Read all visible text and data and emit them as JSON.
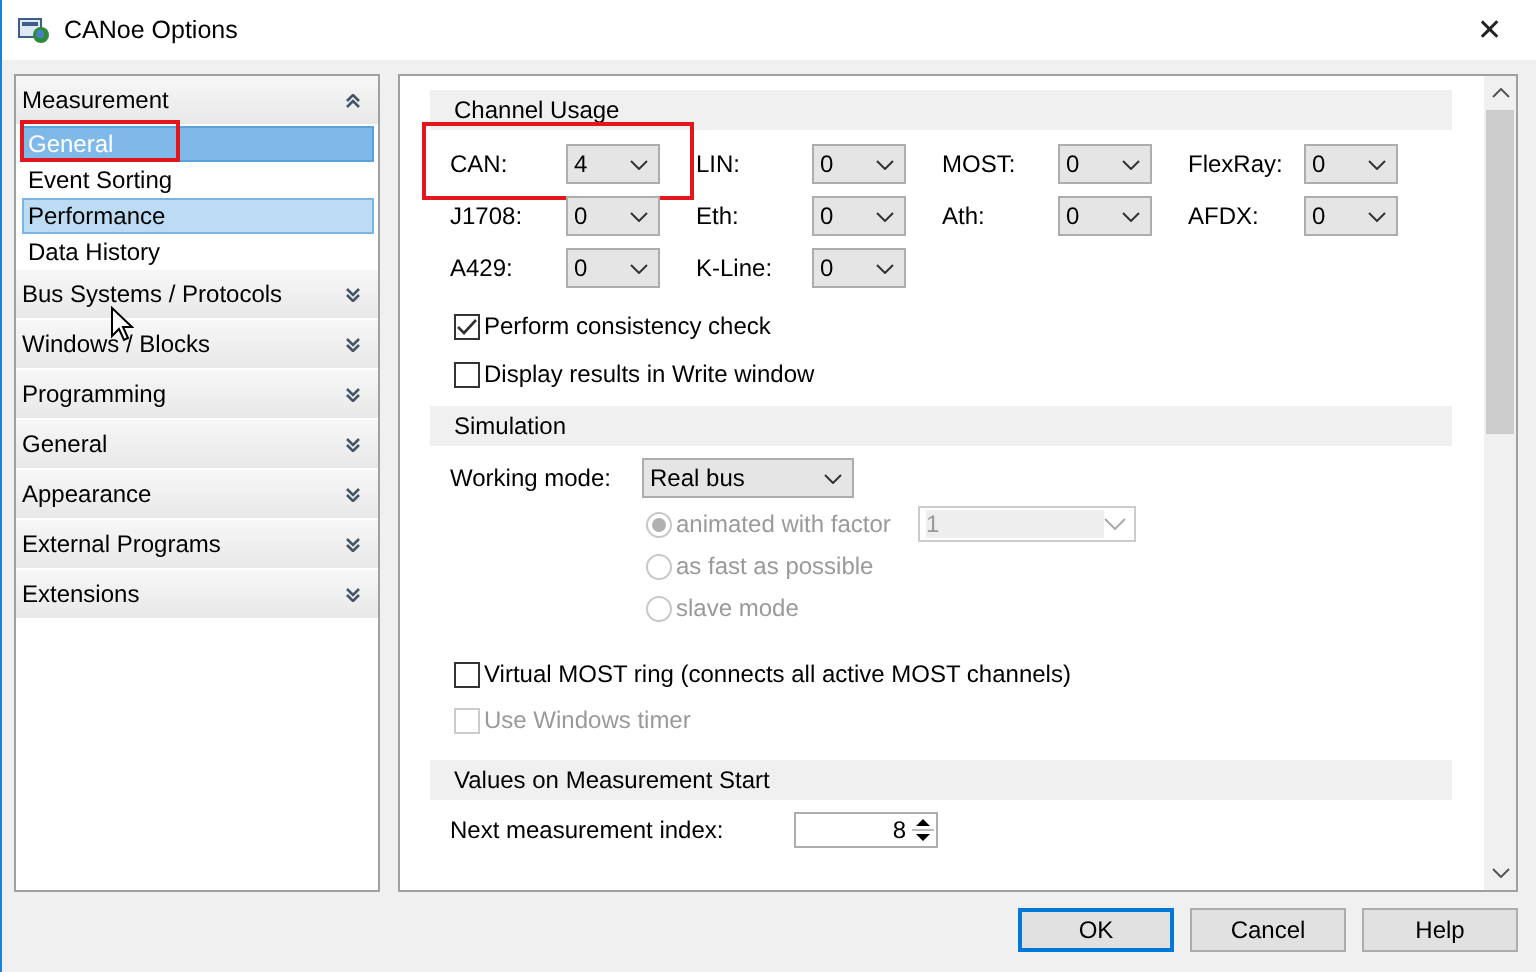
{
  "window": {
    "title": "CANoe Options",
    "close": "✕"
  },
  "sidebar": {
    "sections": [
      {
        "label": "Measurement",
        "expanded": true,
        "items": [
          {
            "label": "General",
            "selected": true,
            "hovered": false,
            "highlighted": true
          },
          {
            "label": "Event Sorting",
            "selected": false,
            "hovered": false,
            "highlighted": false
          },
          {
            "label": "Performance",
            "selected": false,
            "hovered": true,
            "highlighted": false
          },
          {
            "label": "Data History",
            "selected": false,
            "hovered": false,
            "highlighted": false
          }
        ]
      },
      {
        "label": "Bus Systems / Protocols",
        "expanded": false
      },
      {
        "label": "Windows / Blocks",
        "expanded": false
      },
      {
        "label": "Programming",
        "expanded": false
      },
      {
        "label": "General",
        "expanded": false
      },
      {
        "label": "Appearance",
        "expanded": false
      },
      {
        "label": "External Programs",
        "expanded": false
      },
      {
        "label": "Extensions",
        "expanded": false
      }
    ]
  },
  "channel_usage": {
    "title": "Channel Usage",
    "channels": [
      {
        "label": "CAN:",
        "value": "4",
        "highlighted": true
      },
      {
        "label": "LIN:",
        "value": "0",
        "highlighted": false
      },
      {
        "label": "MOST:",
        "value": "0",
        "highlighted": false
      },
      {
        "label": "FlexRay:",
        "value": "0",
        "highlighted": false
      },
      {
        "label": "J1708:",
        "value": "0",
        "highlighted": false
      },
      {
        "label": "Eth:",
        "value": "0",
        "highlighted": false
      },
      {
        "label": "Ath:",
        "value": "0",
        "highlighted": false
      },
      {
        "label": "AFDX:",
        "value": "0",
        "highlighted": false
      },
      {
        "label": "A429:",
        "value": "0",
        "highlighted": false
      },
      {
        "label": "K-Line:",
        "value": "0",
        "highlighted": false
      }
    ],
    "checkboxes": [
      {
        "label": "Perform consistency check",
        "checked": true,
        "disabled": false
      },
      {
        "label": "Display results in Write window",
        "checked": false,
        "disabled": false
      }
    ]
  },
  "simulation": {
    "title": "Simulation",
    "working_mode_label": "Working mode:",
    "working_mode": "Real bus",
    "modes": [
      {
        "label": "animated with factor",
        "selected": true,
        "disabled": true,
        "factor": "1"
      },
      {
        "label": "as fast as possible",
        "selected": false,
        "disabled": true
      },
      {
        "label": "slave mode",
        "selected": false,
        "disabled": true
      }
    ],
    "checkboxes": [
      {
        "label": "Virtual MOST ring (connects all active MOST channels)",
        "checked": false,
        "disabled": false
      },
      {
        "label": "Use Windows timer",
        "checked": false,
        "disabled": true
      }
    ]
  },
  "measurement_start": {
    "title": "Values on Measurement Start",
    "index_label": "Next measurement index:",
    "index_value": "8"
  },
  "buttons": [
    {
      "label": "OK",
      "default": true
    },
    {
      "label": "Cancel",
      "default": false
    },
    {
      "label": "Help",
      "default": false
    }
  ]
}
